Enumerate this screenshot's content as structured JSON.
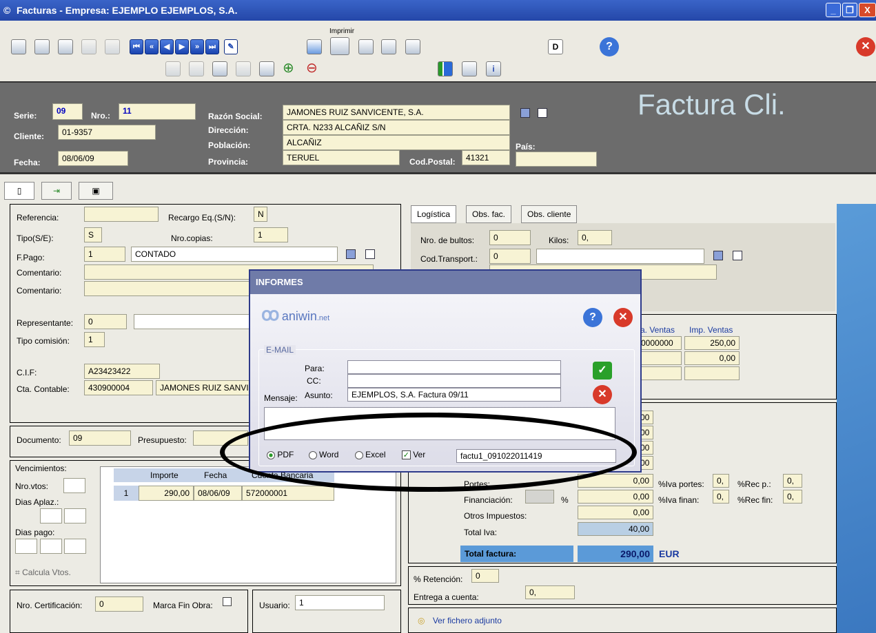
{
  "window": {
    "title": "Facturas - Empresa: EJEMPLO EJEMPLOS, S.A.",
    "min": "_",
    "max": "❐",
    "close": "X"
  },
  "toolbar": {
    "print_label": "Imprimir"
  },
  "header": {
    "serie_label": "Serie:",
    "serie": "09",
    "nro_label": "Nro.:",
    "nro": "11",
    "cliente_label": "Cliente:",
    "cliente": "01-9357",
    "fecha_label": "Fecha:",
    "fecha": "08/06/09",
    "razon_label": "Razón Social:",
    "razon": "JAMONES RUIZ SANVICENTE, S.A.",
    "direccion_label": "Dirección:",
    "direccion": "CRTA. N233 ALCAÑIZ S/N",
    "poblacion_label": "Población:",
    "poblacion": "ALCAÑIZ",
    "provincia_label": "Provincia:",
    "provincia": "TERUEL",
    "cp_label": "Cod.Postal:",
    "cp": "41321",
    "pais_label": "País:",
    "pais": "",
    "title": "Factura Cli."
  },
  "form": {
    "referencia_label": "Referencia:",
    "referencia": "",
    "recargo_label": "Recargo Eq.(S/N):",
    "recargo": "N",
    "tipo_label": "Tipo(S/E):",
    "tipo": "S",
    "copias_label": "Nro.copias:",
    "copias": "1",
    "fpago_label": "F.Pago:",
    "fpago_code": "1",
    "fpago": "CONTADO",
    "comentario_label": "Comentario:",
    "representante_label": "Representante:",
    "representante": "0",
    "comision_label": "Tipo comisión:",
    "comision": "1",
    "cif_label": "C.I.F:",
    "cif": "A23423422",
    "cta_label": "Cta. Contable:",
    "cta": "430900004",
    "cta_name": "JAMONES RUIZ SANVICENTE, S.A.",
    "documento_label": "Documento:",
    "documento": "09",
    "presupuesto_label": "Presupuesto:",
    "venc_label": "Vencimientos:",
    "nrovtos_label": "Nro.vtos:",
    "dias_aplaz_label": "Dias Aplaz.:",
    "dias_pago_label": "Dias pago:",
    "calcula_label": "Calcula Vtos.",
    "venc_headers": [
      "Importe",
      "Fecha",
      "Cuenta Bancaria"
    ],
    "venc_row": {
      "n": "1",
      "importe": "290,00",
      "fecha": "08/06/09",
      "cuenta": "572000001"
    },
    "cert_label": "Nro. Certificación:",
    "cert": "0",
    "marca_label": "Marca Fin Obra:",
    "usuario_label": "Usuario:",
    "usuario": "1"
  },
  "right": {
    "tabs": [
      "Logística",
      "Obs. fac.",
      "Obs. cliente"
    ],
    "bultos_label": "Nro. de bultos:",
    "bultos": "0",
    "kilos_label": "Kilos:",
    "kilos": "0,",
    "transport_label": "Cod.Transport.:",
    "transport": "0",
    "ventas_h1": "a. Ventas",
    "ventas_h2": "Imp. Ventas",
    "ventas_r1a": "0000000",
    "ventas_r1b": "250,00",
    "ventas_r2b": "0,00",
    "totals": [
      "00",
      "00",
      "00",
      "00"
    ],
    "portes_label": "Portes:",
    "portes": "0,00",
    "iva_portes_label": "%Iva portes:",
    "iva_portes": "0,",
    "rec_p_label": "%Rec p.:",
    "rec_p": "0,",
    "fin_label": "Financiación:",
    "fin_pct": "%",
    "fin": "0,00",
    "iva_fin_label": "%Iva finan:",
    "iva_fin": "0,",
    "rec_fin_label": "%Rec fin:",
    "rec_fin": "0,",
    "otros_label": "Otros Impuestos:",
    "otros": "0,00",
    "total_iva_label": "Total Iva:",
    "total_iva": "40,00",
    "total_label": "Total factura:",
    "total": "290,00",
    "currency": "EUR",
    "retencion_label": "% Retención:",
    "retencion": "0",
    "entrega_label": "Entrega a cuenta:",
    "entrega": "0,",
    "adjunto_label": "Ver fichero adjunto"
  },
  "dialog": {
    "title": "INFORMES",
    "logo": "aniwin",
    "logo_suffix": ".net",
    "group": "E-MAIL",
    "para_label": "Para:",
    "cc_label": "CC:",
    "asunto_label": "Asunto:",
    "mensaje_label": "Mensaje:",
    "asunto": "EJEMPLOS, S.A. Factura 09/11",
    "pdf": "PDF",
    "word": "Word",
    "excel": "Excel",
    "ver": "Ver",
    "filename": "factu1_091022011419"
  }
}
